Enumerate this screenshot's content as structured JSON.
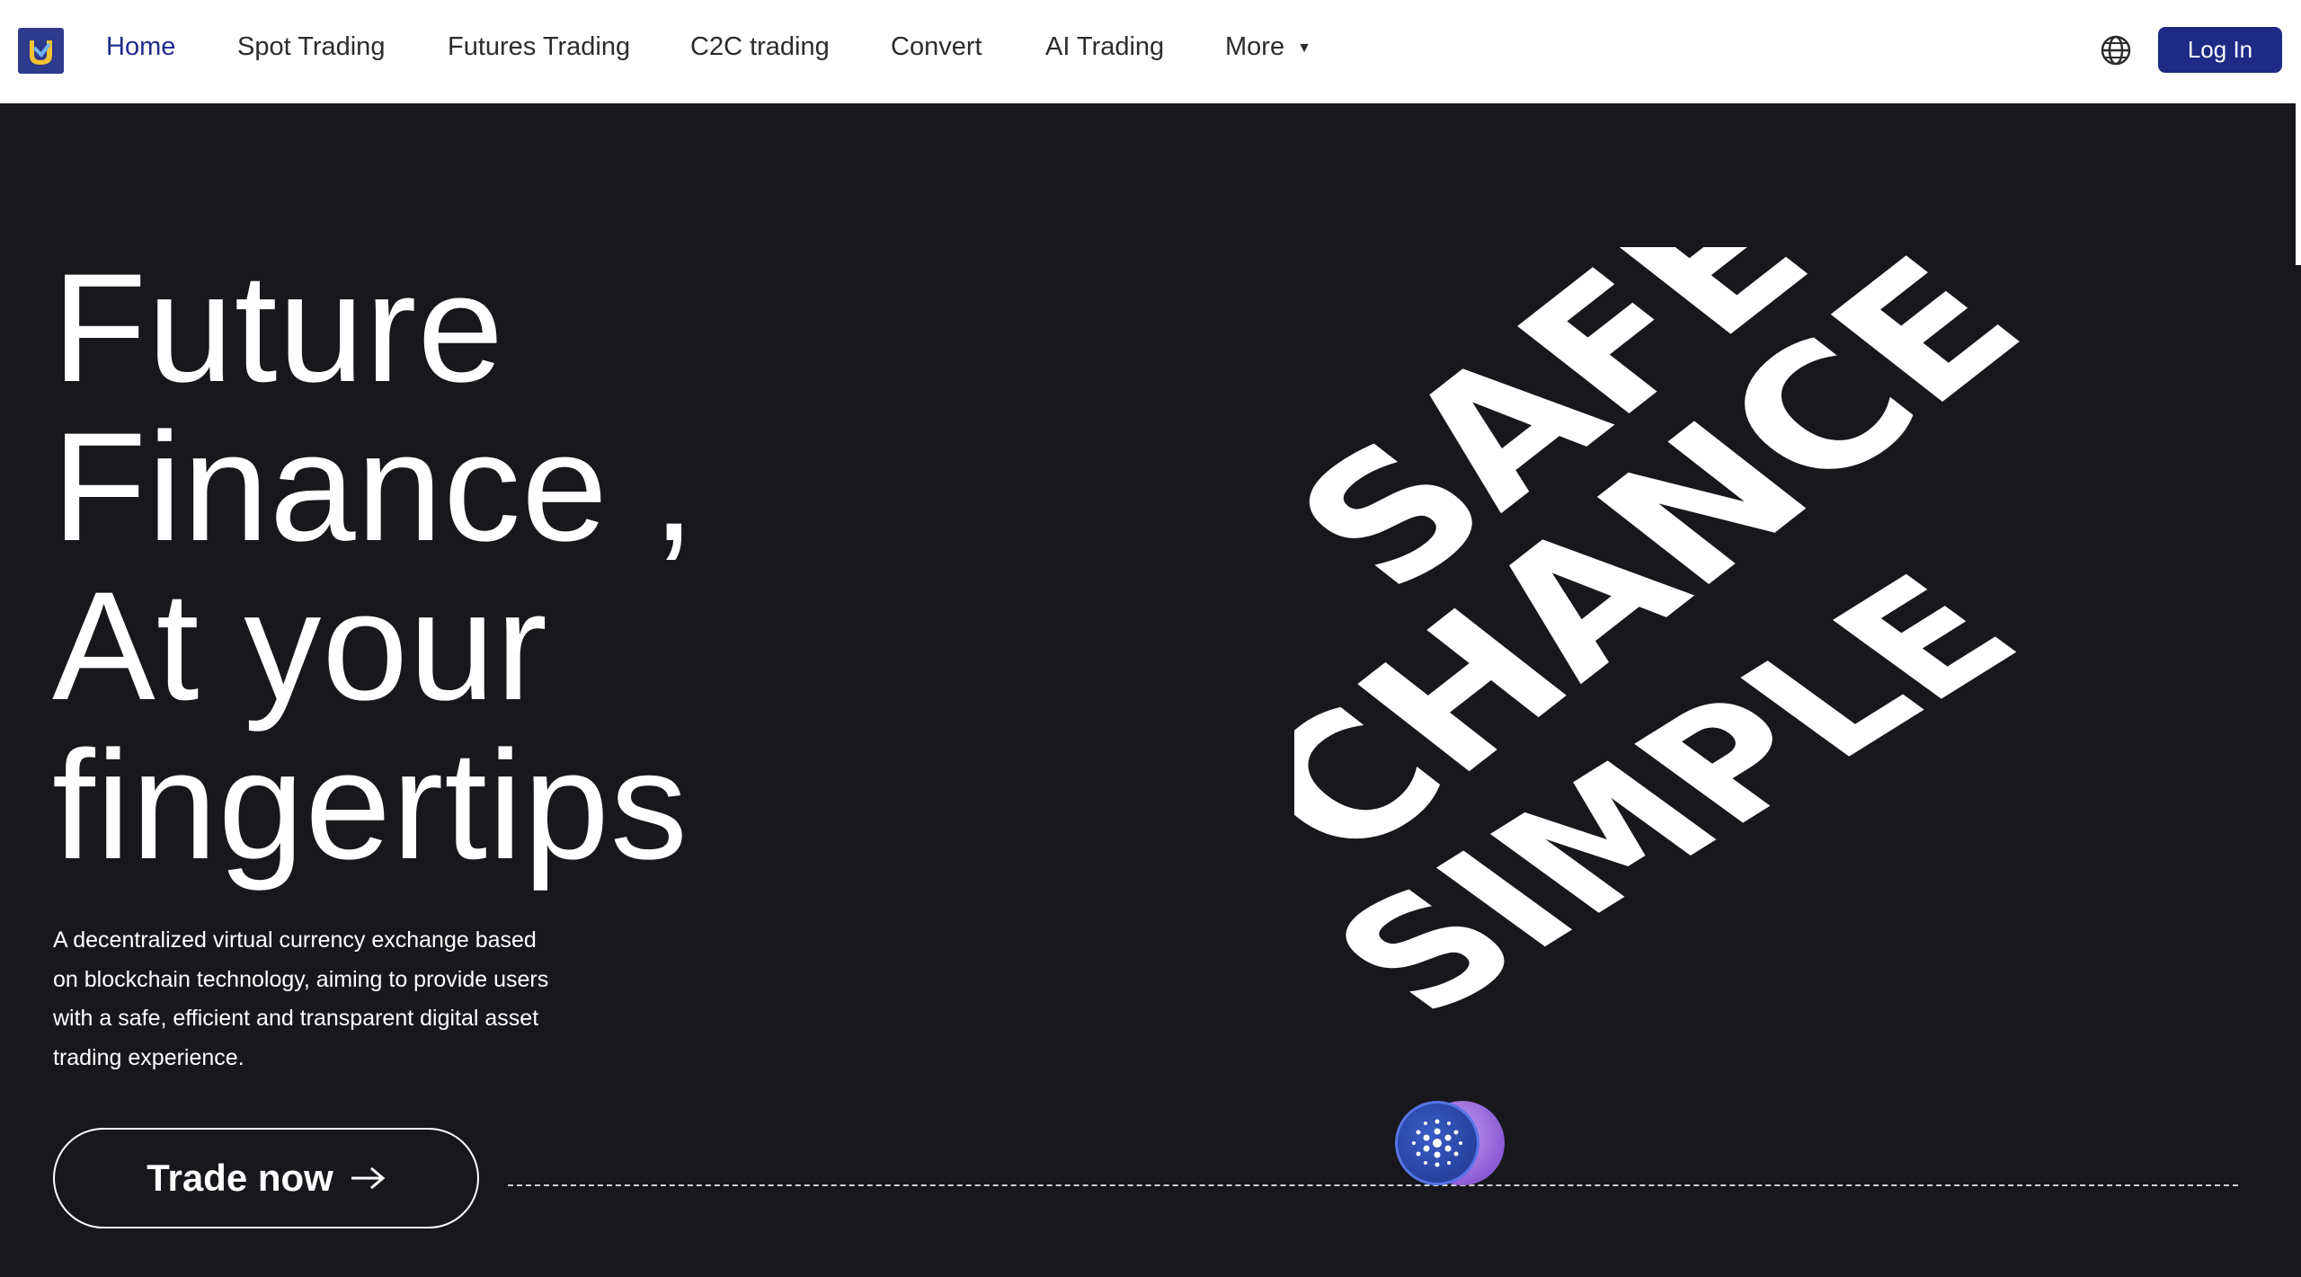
{
  "nav": {
    "links": [
      {
        "label": "Home",
        "active": true
      },
      {
        "label": "Spot Trading"
      },
      {
        "label": "Futures Trading"
      },
      {
        "label": "C2C trading"
      },
      {
        "label": "Convert"
      },
      {
        "label": "AI Trading"
      },
      {
        "label": "More"
      }
    ],
    "more_caret": "▼",
    "login_label": "Log In"
  },
  "hero": {
    "headline": [
      "Future",
      "Finance ,",
      "At your",
      "fingertips"
    ],
    "tagline": "A decentralized virtual currency exchange based on blockchain technology, aiming to provide users with a safe, efficient and transparent digital asset trading experience.",
    "cta_label": "Trade now",
    "graphic_words": [
      "SAFE",
      "CHANCE",
      "SIMPLE"
    ]
  },
  "colors": {
    "brand": "#1e2a86",
    "hero_bg": "#18171c",
    "text_light": "#ffffff",
    "nav_text": "#2c2c2c"
  },
  "icons": {
    "logo": "exchange-logo",
    "language": "globe-icon",
    "cta": "arrow-right-icon",
    "coins": "coin-stack-icon"
  }
}
